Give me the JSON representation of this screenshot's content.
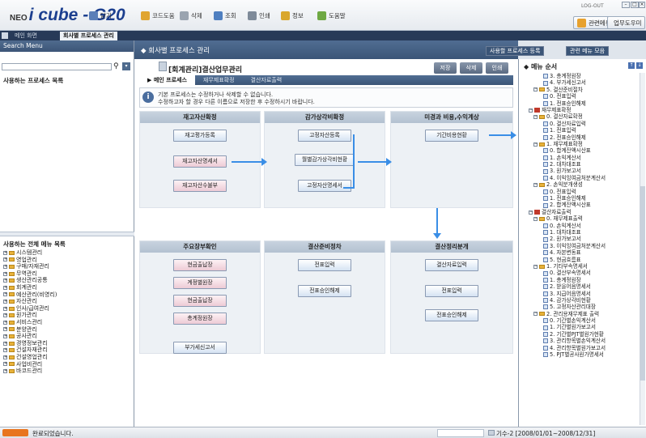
{
  "app": {
    "logo_prefix": "NEO",
    "logo_name": "i cube - G20"
  },
  "toolbar": [
    {
      "label": "닫기",
      "color": "#5b7fb8"
    },
    {
      "label": "코드도움",
      "color": "#e0a530"
    },
    {
      "label": "삭제",
      "color": "#9aa4b0"
    },
    {
      "label": "조회",
      "color": "#4f7fc0"
    },
    {
      "label": "인쇄",
      "color": "#7e8a99"
    },
    {
      "label": "정보",
      "color": "#d9a72d"
    },
    {
      "label": "도움말",
      "color": "#6ea843"
    }
  ],
  "top_right": {
    "logout": "LOG-OUT",
    "related_menu": "관련메뉴",
    "work_help": "업무도우미"
  },
  "window_tabs": [
    "메인 화면",
    "회사별 프로세스 관리"
  ],
  "left": {
    "search_header": "Search Menu",
    "search_value": "",
    "used_process_title": "사용하는 프로세스 목록",
    "all_menu_title": "사용하는 전체 메뉴 목록",
    "menu_items": [
      "시스템관리",
      "영업관리",
      "구매/자재관리",
      "무역관리",
      "생산관리공통",
      "회계관리",
      "예산관리(비영리)",
      "자산관리",
      "인사/급여관리",
      "원가관리",
      "서비스관리",
      "분양관리",
      "공사관리",
      "경영정보관리",
      "건설자재관리",
      "건설영업관리",
      "사업비관리",
      "바코드관리"
    ]
  },
  "main": {
    "header_title": "회사별 프로세스 관리",
    "btn_register": "사용할 프로세스 등록",
    "btn_related": "관련 메뉴 모음",
    "page_title": "[회계관리]결산업무관리",
    "btn_save": "저장",
    "btn_delete": "삭제",
    "btn_print": "인쇄",
    "subtabs": [
      "메인 프로세스",
      "재무제표확정",
      "결산자료출력"
    ],
    "info_line1": "기본 프로세스는 수정하거나 삭제할 수 없습니다.",
    "info_line2": "수정하고자 할 경우 다른 이름으로 저장한 후 수정하시기 바랍니다.",
    "panels": [
      {
        "title": "재고자산확정",
        "buttons": [
          "재고평가등록",
          "재고자산명세서",
          "재고자산수불부"
        ]
      },
      {
        "title": "감가상각비확정",
        "buttons": [
          "고정자산등록",
          "월별감가상각비현황",
          "고정자산명세서"
        ]
      },
      {
        "title": "미경과 비용,수익계상",
        "buttons": [
          "기간비용현황"
        ]
      },
      {
        "title": "주요장부확인",
        "buttons": [
          "현금출납장",
          "계정별원장",
          "현금출납장",
          "총계정원장",
          "부가세신고서"
        ]
      },
      {
        "title": "결산준비정차",
        "buttons": [
          "전표입력",
          "전표승인해제"
        ]
      },
      {
        "title": "결산정리분개",
        "buttons": [
          "결산자료입력",
          "전표입력",
          "전표승인해제"
        ]
      }
    ]
  },
  "right": {
    "title": "메뉴 순서",
    "items": [
      {
        "t": "3. 총계정원장",
        "lvl": 4,
        "k": "doc"
      },
      {
        "t": "4. 부가세신고서",
        "lvl": 4,
        "k": "doc"
      },
      {
        "t": "5. 결산준비절차",
        "lvl": 2,
        "k": "fold"
      },
      {
        "t": "0. 전표입력",
        "lvl": 4,
        "k": "doc"
      },
      {
        "t": "1. 전표승인해제",
        "lvl": 4,
        "k": "doc"
      },
      {
        "t": "재무제표확정",
        "lvl": 1,
        "k": "grp"
      },
      {
        "t": "0. 결산자료확정",
        "lvl": 2,
        "k": "fold"
      },
      {
        "t": "0. 결산자료입력",
        "lvl": 4,
        "k": "doc"
      },
      {
        "t": "1. 전표입력",
        "lvl": 4,
        "k": "doc"
      },
      {
        "t": "2. 전표승인해제",
        "lvl": 4,
        "k": "doc"
      },
      {
        "t": "1. 재무제표확정",
        "lvl": 2,
        "k": "fold"
      },
      {
        "t": "0. 합계잔액시산표",
        "lvl": 4,
        "k": "doc"
      },
      {
        "t": "1. 손익계산서",
        "lvl": 4,
        "k": "doc"
      },
      {
        "t": "2. 대차대조표",
        "lvl": 4,
        "k": "doc"
      },
      {
        "t": "3. 원가보고서",
        "lvl": 4,
        "k": "doc"
      },
      {
        "t": "4. 이익잉여금처분계산서",
        "lvl": 4,
        "k": "doc"
      },
      {
        "t": "2. 손익분개생성",
        "lvl": 2,
        "k": "fold"
      },
      {
        "t": "0. 전표입력",
        "lvl": 4,
        "k": "doc"
      },
      {
        "t": "1. 전표승인해제",
        "lvl": 4,
        "k": "doc"
      },
      {
        "t": "2. 합계잔액시산표",
        "lvl": 4,
        "k": "doc"
      },
      {
        "t": "결산자료출력",
        "lvl": 1,
        "k": "grp"
      },
      {
        "t": "0. 재무제표출력",
        "lvl": 2,
        "k": "fold"
      },
      {
        "t": "0. 손익계산서",
        "lvl": 4,
        "k": "doc"
      },
      {
        "t": "1. 대차대조표",
        "lvl": 4,
        "k": "doc"
      },
      {
        "t": "2. 원가보고서",
        "lvl": 4,
        "k": "doc"
      },
      {
        "t": "3. 이익잉여금처분계산서",
        "lvl": 4,
        "k": "doc"
      },
      {
        "t": "4. 자본변동표",
        "lvl": 4,
        "k": "doc"
      },
      {
        "t": "5. 현금흐름표",
        "lvl": 4,
        "k": "doc"
      },
      {
        "t": "1. 기타부속명세서",
        "lvl": 2,
        "k": "fold"
      },
      {
        "t": "0. 결산부속명세서",
        "lvl": 4,
        "k": "doc"
      },
      {
        "t": "1. 총계정원장",
        "lvl": 4,
        "k": "doc"
      },
      {
        "t": "2. 받을어음명세서",
        "lvl": 4,
        "k": "doc"
      },
      {
        "t": "3. 지급어음명세서",
        "lvl": 4,
        "k": "doc"
      },
      {
        "t": "4. 감가상각비현황",
        "lvl": 4,
        "k": "doc"
      },
      {
        "t": "5. 고정자산관리대장",
        "lvl": 4,
        "k": "doc"
      },
      {
        "t": "2. 관리용재무제표 출력",
        "lvl": 2,
        "k": "fold"
      },
      {
        "t": "0. 기간별손익계산서",
        "lvl": 4,
        "k": "doc"
      },
      {
        "t": "1. 기간별원가보고서",
        "lvl": 4,
        "k": "doc"
      },
      {
        "t": "2. 기간별PJT별원가현황",
        "lvl": 4,
        "k": "doc"
      },
      {
        "t": "3. 관리항목별손익계산서",
        "lvl": 4,
        "k": "doc"
      },
      {
        "t": "4. 관리항목별원가보고서",
        "lvl": 4,
        "k": "doc"
      },
      {
        "t": "5. PJT별공사원가명세서",
        "lvl": 4,
        "k": "doc"
      }
    ]
  },
  "status": {
    "message": "완료되었습니다.",
    "info": "기수-2 [2008/01/01~2008/12/31]"
  }
}
